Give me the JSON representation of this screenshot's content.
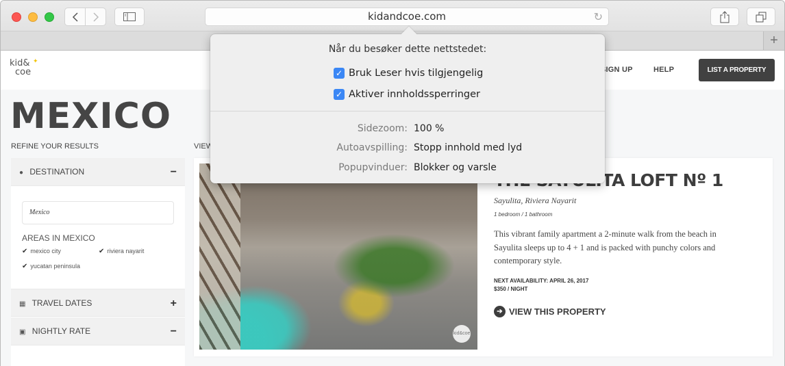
{
  "browser": {
    "url": "kidandcoe.com",
    "buttons": {
      "back": "back-icon",
      "forward": "forward-icon",
      "sidebar": "sidebar-icon",
      "reload": "reload-icon",
      "share": "share-icon",
      "tabs": "tabs-icon",
      "new_tab": "+"
    }
  },
  "site": {
    "logo_line1": "kid&",
    "logo_line2": "coe",
    "nav": {
      "signup": "SIGN UP",
      "help": "HELP",
      "list_property": "LIST A PROPERTY"
    },
    "page_title": "MEXICO",
    "refine_label": "REFINE YOUR RESULTS",
    "view_label": "VIEW",
    "filters": {
      "destination": {
        "label": "DESTINATION",
        "toggle": "−",
        "input_value": "Mexico"
      },
      "areas_title": "AREAS IN MEXICO",
      "areas": [
        {
          "label": "mexico city",
          "checked": true
        },
        {
          "label": "riviera nayarit",
          "checked": true
        },
        {
          "label": "yucatan peninsula",
          "checked": true
        }
      ],
      "travel_dates": {
        "label": "TRAVEL DATES",
        "toggle": "+"
      },
      "nightly_rate": {
        "label": "NIGHTLY RATE",
        "toggle": "−"
      }
    },
    "listing": {
      "title": "THE SAYULITA LOFT Nº 1",
      "location": "Sayulita, Riviera Nayarit",
      "rooms": "1 bedroom / 1 bathroom",
      "description": "This vibrant family apartment a 2-minute walk from the beach in Sayulita sleeps up to 4 + 1 and is packed with punchy colors and contemporary style.",
      "availability": "NEXT AVAILABILITY: APRIL 26, 2017",
      "price": "$350 / NIGHT",
      "cta": "VIEW THIS PROPERTY",
      "photo_badge": "kid&coe"
    }
  },
  "popover": {
    "title": "Når du besøker dette nettstedet:",
    "checkboxes": [
      {
        "label": "Bruk Leser hvis tilgjengelig",
        "checked": true
      },
      {
        "label": "Aktiver innholdssperringer",
        "checked": true
      }
    ],
    "settings": [
      {
        "label": "Sidezoom:",
        "value": "100 %"
      },
      {
        "label": "Autoavspilling:",
        "value": "Stopp innhold med lyd"
      },
      {
        "label": "Popupvinduer:",
        "value": "Blokker og varsle"
      }
    ],
    "accent_color": "#3b87f5"
  }
}
